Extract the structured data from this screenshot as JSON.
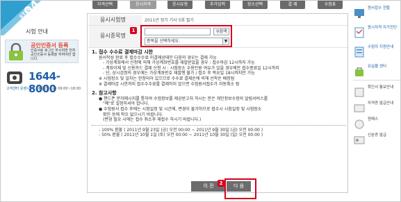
{
  "step": {
    "label": "STEP",
    "number": "04"
  },
  "left": {
    "site_title": "시험 안내",
    "cert_title": "공인인증서 등록",
    "cert_desc": "인증서로 로그인 하시려면 먼저 공인인증서 등록을 하여야만 합니다.",
    "call_number": "1644-8000",
    "call_hours_label": "고객센터 운영시간",
    "call_hours_value": "평일(월~금) 09:00~18:00"
  },
  "tabs": [
    "자격선택",
    "응시자격",
    "응시유형",
    "추가입력",
    "장소선택",
    "결 제",
    "수험표"
  ],
  "active_tab": 1,
  "form": {
    "exam_label": "응시시험명",
    "exam_value": "2011년 정기 기사 5회 필기",
    "region_label": "응시종목명",
    "search_button": "검색",
    "select_placeholder": "종목을 선택하세요.",
    "select_arrow": "▼"
  },
  "badges": {
    "one": "1",
    "two": "2"
  },
  "notice": {
    "h1": "1. 접수 수수료 결제마감 시한",
    "l1": "원서작성 완료 후 접수수수료 미결제상태인 다음의 경우는 결제 가능",
    "l2": "- 가상계좌에서 신청에 의해 가상계좌번호를 재발받았을 경우 : 접수마감 12시까지 가능",
    "l3": "- 계좌이체 및 신용카드 결제 신청 시 : 시험장소 수용인원 여유가 있을 경우에만 접수종료일 12시까지",
    "l4": "- 단, 상시검정의 경우에는 가상계좌번호 재발행 불가 / 접수 후 목요일 18시까지만 가능",
    "l5": "※ 시험장소 및 일자는 한정되어 있으므로 수수료 결제순에 의해 선착순 배정됨",
    "l6": "※ 결제마감 시한까지 접수수수료를 결제하지 않으면 수험원서접수가 자동취소 됨",
    "h2": "2. 참고사항",
    "l7": "● 핸드폰 문자메시지를 통하여 수험정보를 제공받고자 하시는 분은 개인정보수정의 알림서비스를",
    "l8": "\"예\"로 설정하셔야 합니다.",
    "l9": "● 수험원서 접수 후에는 시험일정 및 시간에, 변경이 불가하므로 접수시 시험일정 및 시험장소",
    "l10": "확인 등에 착오 없으시기 바랍니다.",
    "l11": "(변경 필요 시에는 접수 취소후 재접수 하시기 바랍니다.)",
    "l12": "- 100% 환불 ( 2011년 9월 23일 (금) 오전 00:00 ~ 2011년 9월 30일 (금) 오전 00:00 )",
    "l13": "- 50% 환불 ( 2011년 10월 1일 (토) 오전 00:00 ~ 2011년 10월 30일 (일) 오전 00:00 )"
  },
  "buttons": {
    "prev": "이 전",
    "next": "다 음"
  },
  "right": {
    "items": [
      "원서접수 현황",
      "응시자격 자가진단",
      "수험자 지원안내",
      "유실물 센터",
      "확인서 통보안내",
      "자격증 발급안내",
      "원패스",
      "신분증 발급"
    ]
  },
  "colors": {
    "accent": "#d6001c",
    "brand": "#1f5faa",
    "step_bg": "#2e9fcf"
  }
}
